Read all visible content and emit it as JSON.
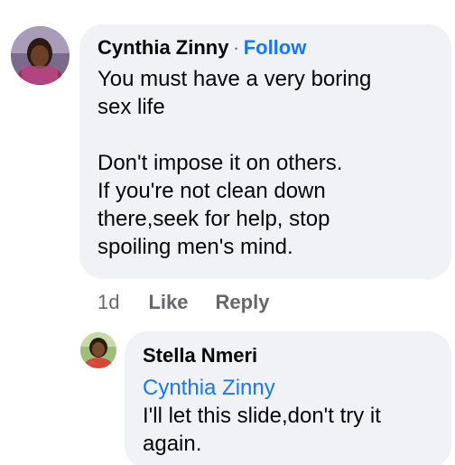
{
  "comment": {
    "author": "Cynthia Zinny",
    "separator": "·",
    "follow_label": "Follow",
    "text": "You must have a very boring\nsex life\n\nDon't impose it on others.\nIf you're not clean down\nthere,seek for help, stop\nspoiling men's mind.",
    "time": "1d",
    "like_label": "Like",
    "reply_label": "Reply"
  },
  "reply": {
    "author": "Stella Nmeri",
    "mention": "Cynthia Zinny",
    "text": "I'll let this slide,don't try it\nagain."
  },
  "colors": {
    "bubble_bg": "#f0f2f5",
    "link_blue": "#1877f2",
    "meta_gray": "#65676b"
  }
}
